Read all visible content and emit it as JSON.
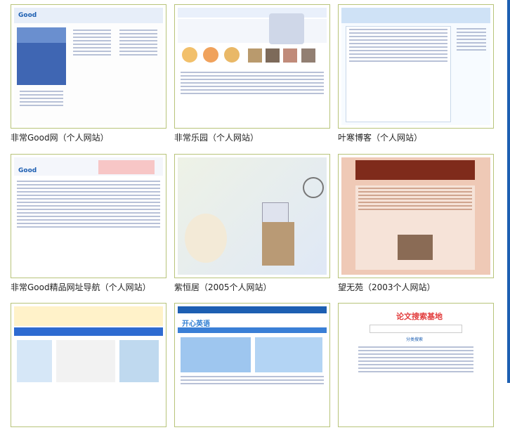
{
  "gallery": [
    {
      "caption": "非常Good网（个人网站）",
      "screenshot": "feichang-good-site"
    },
    {
      "caption": "非常乐园（个人网站）",
      "screenshot": "feichang-leyuan-site"
    },
    {
      "caption": "叶寒博客（个人网站）",
      "screenshot": "yehan-blog-site"
    },
    {
      "caption": "非常Good精品网址导航（个人网站）",
      "screenshot": "good-nav-site"
    },
    {
      "caption": "紫恒居（2005个人网站）",
      "screenshot": "ziheng-site"
    },
    {
      "caption": "望无苑（2003个人网站）",
      "screenshot": "wangwuyuan-site"
    },
    {
      "caption": "",
      "screenshot": "bottom-left-site"
    },
    {
      "caption": "",
      "screenshot": "kaixin-english-site"
    },
    {
      "caption": "",
      "screenshot": "lunwen-search-site"
    }
  ],
  "thumb_text": {
    "good_logo": "Good",
    "kaixin_logo": "开心英语",
    "lunwen_title": "论文搜索基地",
    "lunwen_sub": "分类搜索"
  },
  "colors": {
    "thumb_border": "#b8c47a",
    "accent_blue": "#1d5fb2"
  }
}
